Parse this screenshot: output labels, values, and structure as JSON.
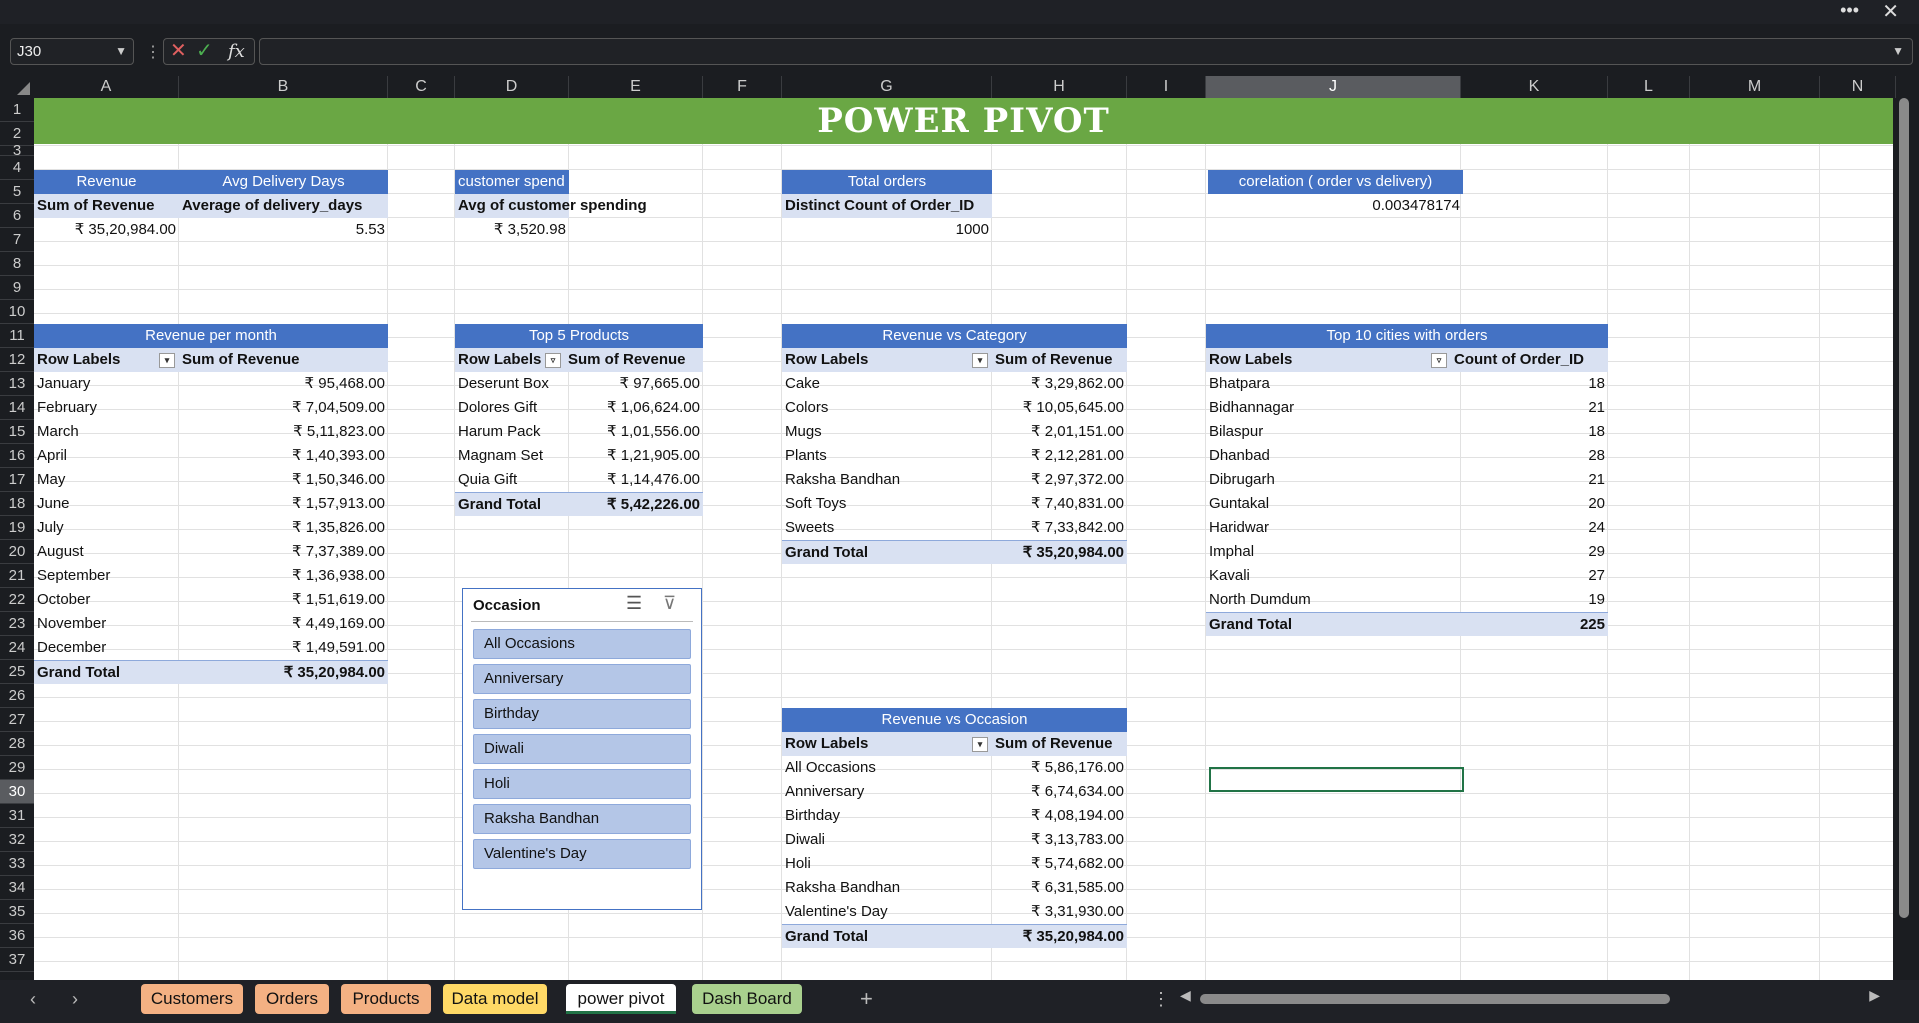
{
  "namebox": {
    "value": "J30"
  },
  "columns": [
    "A",
    "B",
    "C",
    "D",
    "E",
    "F",
    "G",
    "H",
    "I",
    "J",
    "K",
    "L",
    "M",
    "N"
  ],
  "rows": [
    "1",
    "2",
    "3",
    "4",
    "5",
    "6",
    "7",
    "8",
    "9",
    "10",
    "11",
    "12",
    "13",
    "14",
    "15",
    "16",
    "17",
    "18",
    "19",
    "20",
    "21",
    "22",
    "23",
    "24",
    "25",
    "26",
    "27",
    "28",
    "29",
    "30",
    "31",
    "32",
    "33",
    "34",
    "35",
    "36",
    "37"
  ],
  "banner": "POWER PIVOT",
  "kpi": {
    "revenue": {
      "header": "Revenue",
      "sub": "Sum of Revenue",
      "value": "₹ 35,20,984.00"
    },
    "delivery": {
      "header": "Avg Delivery Days",
      "sub": "Average of delivery_days",
      "value": "5.53"
    },
    "spend": {
      "header": "customer spend",
      "sub": "Avg of customer spending",
      "value": "₹ 3,520.98"
    },
    "orders": {
      "header": "Total orders",
      "sub": "Distinct Count of Order_ID",
      "value": "1000"
    },
    "corr": {
      "header": "corelation ( order vs delivery)",
      "value": "0.003478174"
    }
  },
  "month": {
    "title": "Revenue per month",
    "col1": "Row Labels",
    "col2": "Sum of Revenue",
    "rows": [
      [
        "January",
        "₹ 95,468.00"
      ],
      [
        "February",
        "₹ 7,04,509.00"
      ],
      [
        "March",
        "₹ 5,11,823.00"
      ],
      [
        "April",
        "₹ 1,40,393.00"
      ],
      [
        "May",
        "₹ 1,50,346.00"
      ],
      [
        "June",
        "₹ 1,57,913.00"
      ],
      [
        "July",
        "₹ 1,35,826.00"
      ],
      [
        "August",
        "₹ 7,37,389.00"
      ],
      [
        "September",
        "₹ 1,36,938.00"
      ],
      [
        "October",
        "₹ 1,51,619.00"
      ],
      [
        "November",
        "₹ 4,49,169.00"
      ],
      [
        "December",
        "₹ 1,49,591.00"
      ]
    ],
    "total": [
      "Grand Total",
      "₹ 35,20,984.00"
    ]
  },
  "products": {
    "title": "Top 5 Products",
    "col1": "Row Labels",
    "col2": "Sum of Revenue",
    "rows": [
      [
        "Deserunt Box",
        "₹ 97,665.00"
      ],
      [
        "Dolores Gift",
        "₹ 1,06,624.00"
      ],
      [
        "Harum Pack",
        "₹ 1,01,556.00"
      ],
      [
        "Magnam Set",
        "₹ 1,21,905.00"
      ],
      [
        "Quia Gift",
        "₹ 1,14,476.00"
      ]
    ],
    "total": [
      "Grand Total",
      "₹ 5,42,226.00"
    ]
  },
  "category": {
    "title": "Revenue vs Category",
    "col1": "Row Labels",
    "col2": "Sum of Revenue",
    "rows": [
      [
        "Cake",
        "₹ 3,29,862.00"
      ],
      [
        "Colors",
        "₹ 10,05,645.00"
      ],
      [
        "Mugs",
        "₹ 2,01,151.00"
      ],
      [
        "Plants",
        "₹ 2,12,281.00"
      ],
      [
        "Raksha Bandhan",
        "₹ 2,97,372.00"
      ],
      [
        "Soft Toys",
        "₹ 7,40,831.00"
      ],
      [
        "Sweets",
        "₹ 7,33,842.00"
      ]
    ],
    "total": [
      "Grand Total",
      "₹ 35,20,984.00"
    ]
  },
  "cities": {
    "title": "Top 10 cities with orders",
    "col1": "Row Labels",
    "col2": "Count of Order_ID",
    "rows": [
      [
        "Bhatpara",
        "18"
      ],
      [
        "Bidhannagar",
        "21"
      ],
      [
        "Bilaspur",
        "18"
      ],
      [
        "Dhanbad",
        "28"
      ],
      [
        "Dibrugarh",
        "21"
      ],
      [
        "Guntakal",
        "20"
      ],
      [
        "Haridwar",
        "24"
      ],
      [
        "Imphal",
        "29"
      ],
      [
        "Kavali",
        "27"
      ],
      [
        "North Dumdum",
        "19"
      ]
    ],
    "total": [
      "Grand Total",
      "225"
    ]
  },
  "occasion": {
    "title": "Revenue vs Occasion",
    "col1": "Row Labels",
    "col2": "Sum of Revenue",
    "rows": [
      [
        "All Occasions",
        "₹ 5,86,176.00"
      ],
      [
        "Anniversary",
        "₹ 6,74,634.00"
      ],
      [
        "Birthday",
        "₹ 4,08,194.00"
      ],
      [
        "Diwali",
        "₹ 3,13,783.00"
      ],
      [
        "Holi",
        "₹ 5,74,682.00"
      ],
      [
        "Raksha Bandhan",
        "₹ 6,31,585.00"
      ],
      [
        "Valentine's Day",
        "₹ 3,31,930.00"
      ]
    ],
    "total": [
      "Grand Total",
      "₹ 35,20,984.00"
    ]
  },
  "slicer": {
    "title": "Occasion",
    "items": [
      "All Occasions",
      "Anniversary",
      "Birthday",
      "Diwali",
      "Holi",
      "Raksha Bandhan",
      "Valentine's Day"
    ]
  },
  "tabs": [
    {
      "label": "Customers",
      "color": "#f4b183"
    },
    {
      "label": "Orders",
      "color": "#f4b183"
    },
    {
      "label": "Products",
      "color": "#f4b183"
    },
    {
      "label": "Data model",
      "color": "#ffd966"
    },
    {
      "label": "power pivot",
      "color": "#ffffff"
    },
    {
      "label": "Dash Board",
      "color": "#a9d08e"
    }
  ],
  "add_sheet": "+"
}
